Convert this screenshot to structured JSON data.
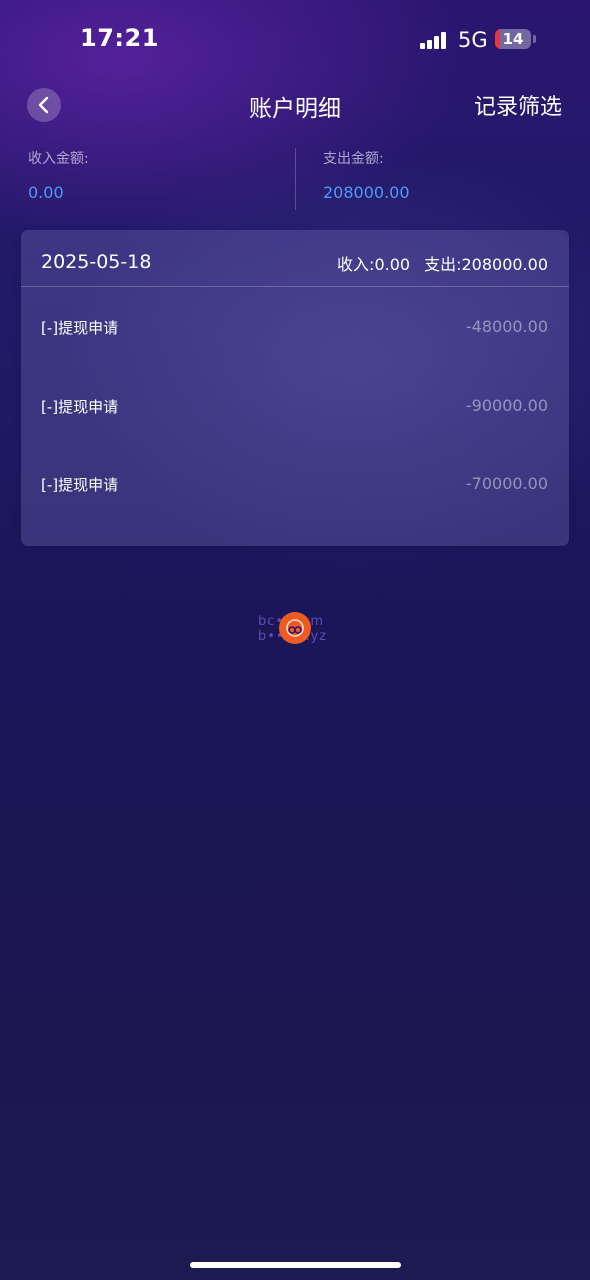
{
  "status_bar": {
    "time": "17:21",
    "network": "5G",
    "battery_level": "14",
    "battery_color": "#e0383f"
  },
  "header": {
    "back_icon": "chevron-left-icon",
    "title": "账户明细",
    "filter_label": "记录筛选"
  },
  "summary": {
    "income_label": "收入金额:",
    "income_value": "0.00",
    "expense_label": "支出金额:",
    "expense_value": "208000.00",
    "value_color": "#4c9af2"
  },
  "records": {
    "date": "2025-05-18",
    "income_total": "收入:0.00",
    "expense_total": "支出:208000.00",
    "items": [
      {
        "label": "[-]提现申请",
        "amount": "-48000.00"
      },
      {
        "label": "[-]提现申请",
        "amount": "-90000.00"
      },
      {
        "label": "[-]提现申请",
        "amount": "-70000.00"
      }
    ]
  },
  "watermark": {
    "line1": "bc•••om",
    "line2": "b••••xyz",
    "logo_color": "#ef5a20"
  }
}
